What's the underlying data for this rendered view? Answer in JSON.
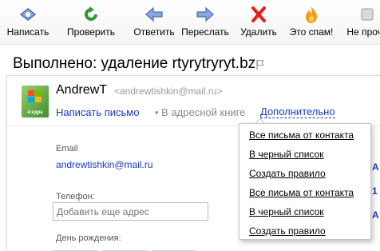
{
  "toolbar": {
    "buttons": [
      {
        "id": "compose",
        "label": "Написать",
        "icon": "compose-icon"
      },
      {
        "id": "check",
        "label": "Проверить",
        "icon": "refresh-icon"
      },
      {
        "id": "reply",
        "label": "Ответить",
        "icon": "reply-icon"
      },
      {
        "id": "forward",
        "label": "Переслать",
        "icon": "forward-icon"
      },
      {
        "id": "delete",
        "label": "Удалить",
        "icon": "delete-icon"
      },
      {
        "id": "spam",
        "label": "Это спам!",
        "icon": "spam-fire-icon"
      },
      {
        "id": "notspam",
        "label": "Не прочи",
        "icon": "not-spam-icon"
      }
    ]
  },
  "page": {
    "title": "Выполнено: удаление rtyrytryryt.bz"
  },
  "contact": {
    "name": "AndrewT",
    "email_header": "<andrewtishkin@mail.ru>",
    "write_link": "Написать письмо",
    "address_book": "• В адресной книге",
    "more_link": "Дополнительно",
    "avatar_caption": "4 ядра"
  },
  "fields": {
    "email_label": "Email",
    "email_value": "andrewtishkin@mail.ru",
    "phone_label": "Телефон:",
    "phone_placeholder": "Добавить еще адрес",
    "birthday_label": "День рождения:"
  },
  "dropdown": {
    "items": [
      "Все письма от контакта",
      "В черный список",
      "Создать правило",
      "Все письма от контакта",
      "В черный список",
      "Создать правило"
    ]
  },
  "colors": {
    "link": "#1a3dc1",
    "muted": "#9a9a9a",
    "delete_red": "#e02020",
    "refresh_green": "#2e9a2e",
    "arrow_blue": "#5a7fd0"
  }
}
